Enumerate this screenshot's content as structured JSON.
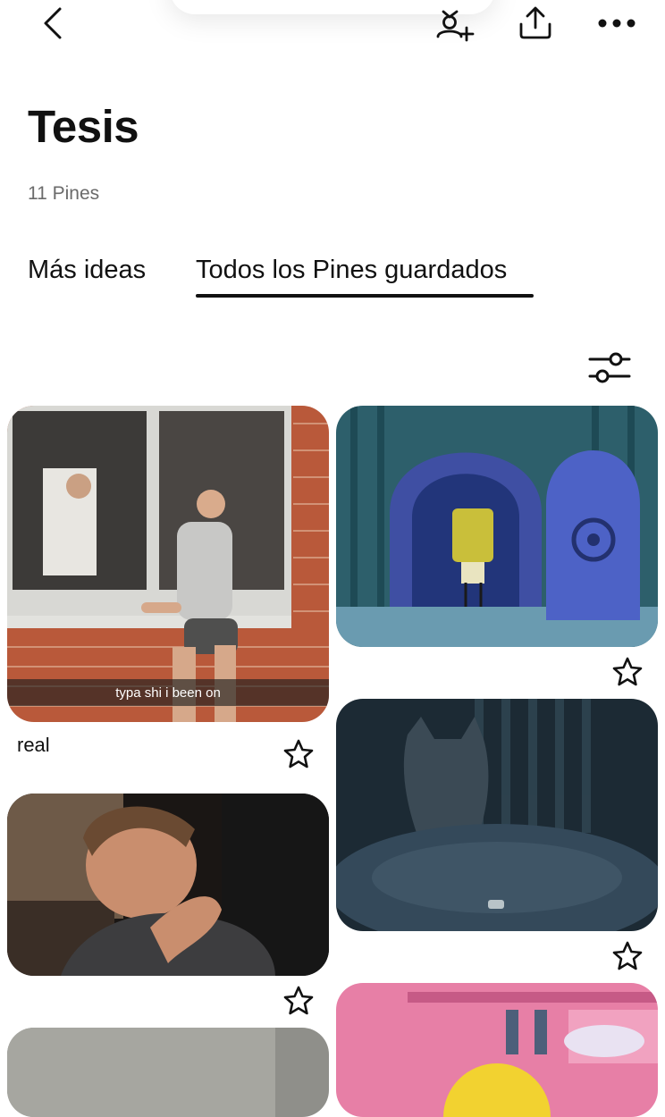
{
  "board": {
    "title": "Tesis",
    "pin_count": "11 Pines"
  },
  "tabs": [
    {
      "label": "Más ideas",
      "active": false
    },
    {
      "label": "Todos los Pines guardados",
      "active": true
    }
  ],
  "icons": {
    "back": "chevron-left-icon",
    "collaborator": "add-collaborator-icon",
    "share": "share-icon",
    "more": "more-options-icon",
    "filter": "filter-sliders-icon",
    "favorite": "star-icon"
  },
  "pins": [
    {
      "id": "man-window",
      "overlay_text": "typa shi i been on",
      "caption": "real"
    },
    {
      "id": "spongebob-door"
    },
    {
      "id": "cat-bed"
    },
    {
      "id": "man-crying"
    },
    {
      "id": "homer-pink"
    },
    {
      "id": "partial-grey"
    }
  ]
}
